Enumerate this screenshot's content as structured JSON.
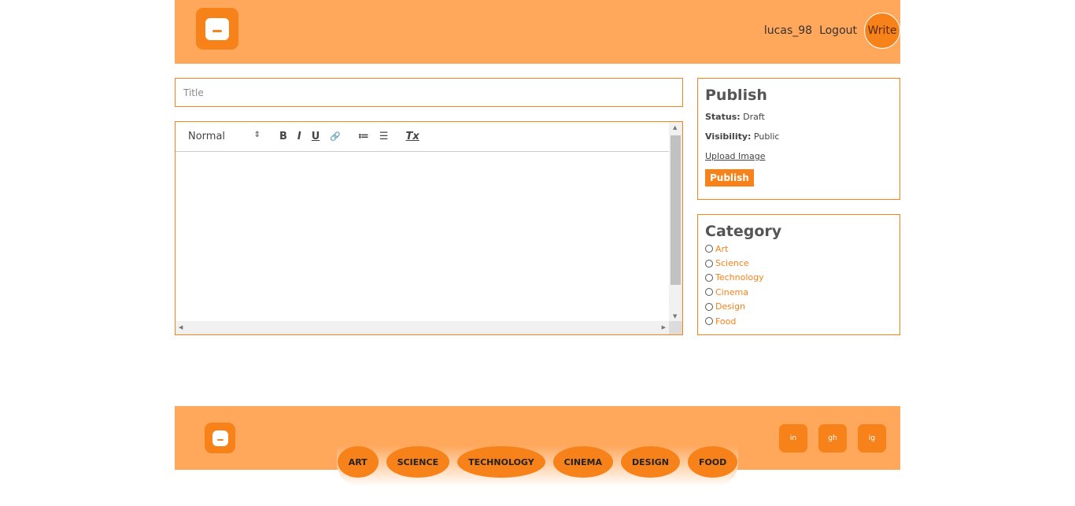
{
  "header": {
    "username": "lucas_98",
    "logout": "Logout",
    "write": "Write"
  },
  "editor": {
    "title_placeholder": "Title",
    "format": "Normal",
    "format_arrow": "⇕",
    "bold": "B",
    "italic": "I",
    "underline": "U",
    "link": "🔗",
    "ordered_list": "≔",
    "bullet_list": "☰",
    "clear": "Tx"
  },
  "publish": {
    "heading": "Publish",
    "status_label": "Status:",
    "status_value": "Draft",
    "visibility_label": "Visibility:",
    "visibility_value": "Public",
    "upload": "Upload Image",
    "button": "Publish"
  },
  "category": {
    "heading": "Category",
    "items": [
      "Art",
      "Science",
      "Technology",
      "Cinema",
      "Design",
      "Food"
    ]
  },
  "footer": {
    "categories": [
      "ART",
      "SCIENCE",
      "TECHNOLOGY",
      "CINEMA",
      "DESIGN",
      "FOOD"
    ],
    "social": [
      "in",
      "gh",
      "ig"
    ]
  },
  "colors": {
    "accent": "#f8821a",
    "header": "#ffa75b"
  }
}
